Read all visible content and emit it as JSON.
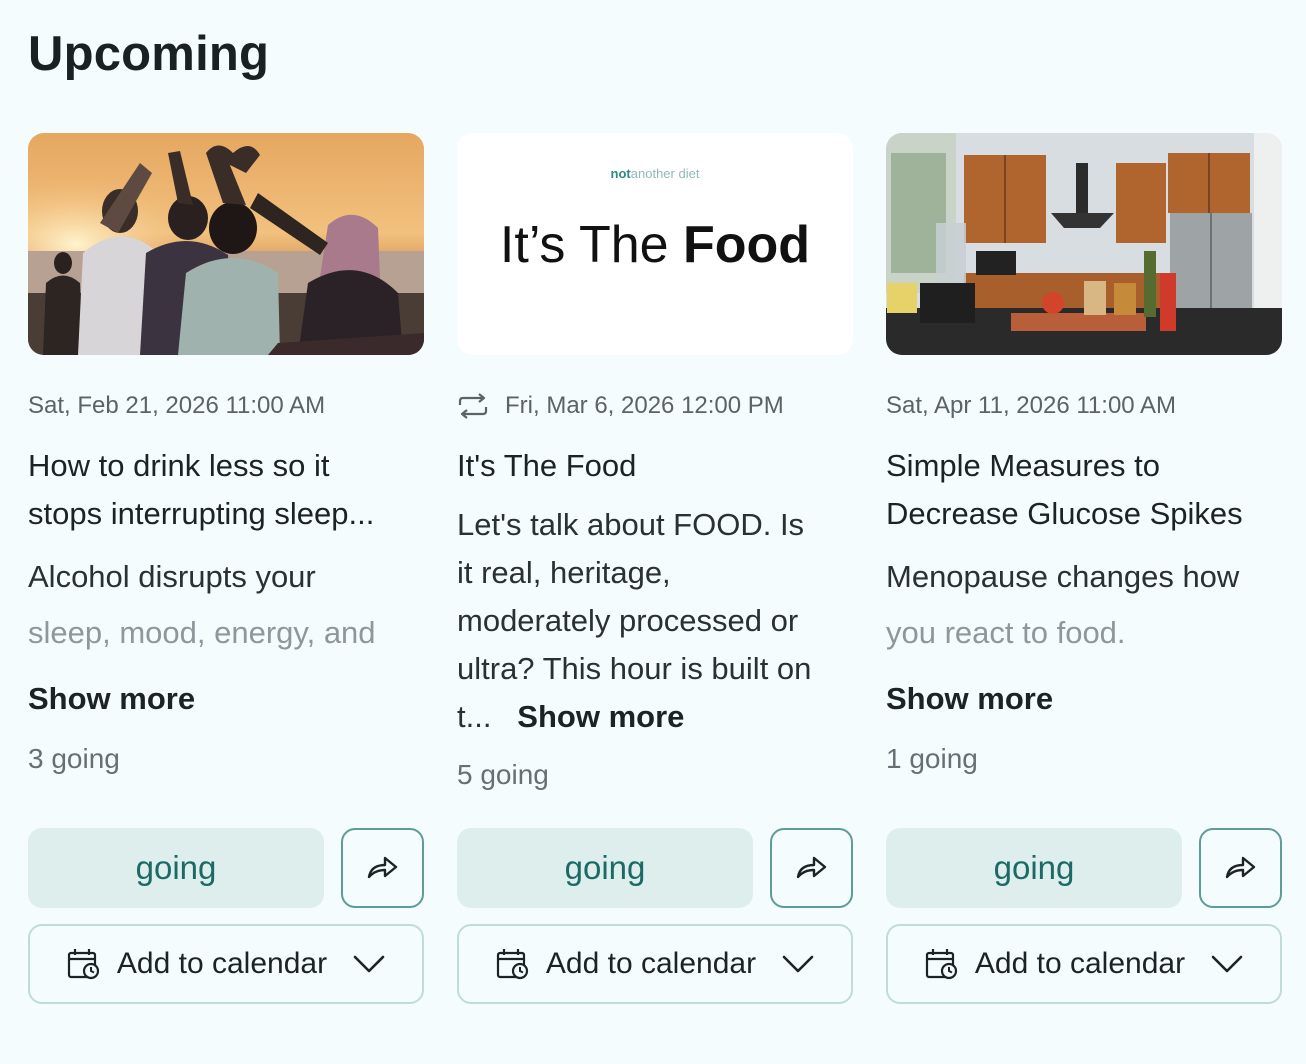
{
  "page": {
    "title": "Upcoming"
  },
  "cards": [
    {
      "date": "Sat, Feb 21, 2026 11:00 AM",
      "recurring": false,
      "title_line1": "How to drink less so it",
      "title_line2": "stops interrupting sleep...",
      "desc_line1": "Alcohol disrupts your",
      "desc_line2": "sleep, mood, energy, and",
      "show_more": "Show more",
      "going_count": "3 going",
      "going_label": "going",
      "calendar_label": "Add to calendar"
    },
    {
      "date": "Fri, Mar 6, 2026 12:00 PM",
      "recurring": true,
      "title_line1": "It's The Food",
      "desc_line1": "Let's talk about FOOD. Is",
      "desc_line2": "it real, heritage,",
      "desc_line3": "moderately processed or",
      "desc_line4": "ultra? This hour is built on",
      "desc_line5": "t...",
      "show_more": "Show more",
      "going_count": "5 going",
      "going_label": "going",
      "calendar_label": "Add to calendar",
      "image_brand": "not another diet",
      "image_brand_bold": "not",
      "image_brand_rest": "another diet",
      "image_headline_light": "It’s The",
      "image_headline_bold": "Food"
    },
    {
      "date": "Sat, Apr 11, 2026 11:00 AM",
      "recurring": false,
      "title_line1": "Simple Measures to",
      "title_line2": "Decrease Glucose Spikes",
      "desc_line1": "Menopause changes how",
      "desc_line2": "you react to food.",
      "show_more": "Show more",
      "going_count": "1 going",
      "going_label": "going",
      "calendar_label": "Add to calendar"
    }
  ],
  "colors": {
    "background": "#f4fcfd",
    "accent": "#1b6a66",
    "going_bg": "#deeeed",
    "share_border": "#5f9b98",
    "calendar_border": "#bfdcda"
  },
  "icons": {
    "repeat": "repeat-icon",
    "share": "share-icon",
    "calendar": "calendar-clock-icon",
    "chevron": "chevron-down-icon"
  }
}
